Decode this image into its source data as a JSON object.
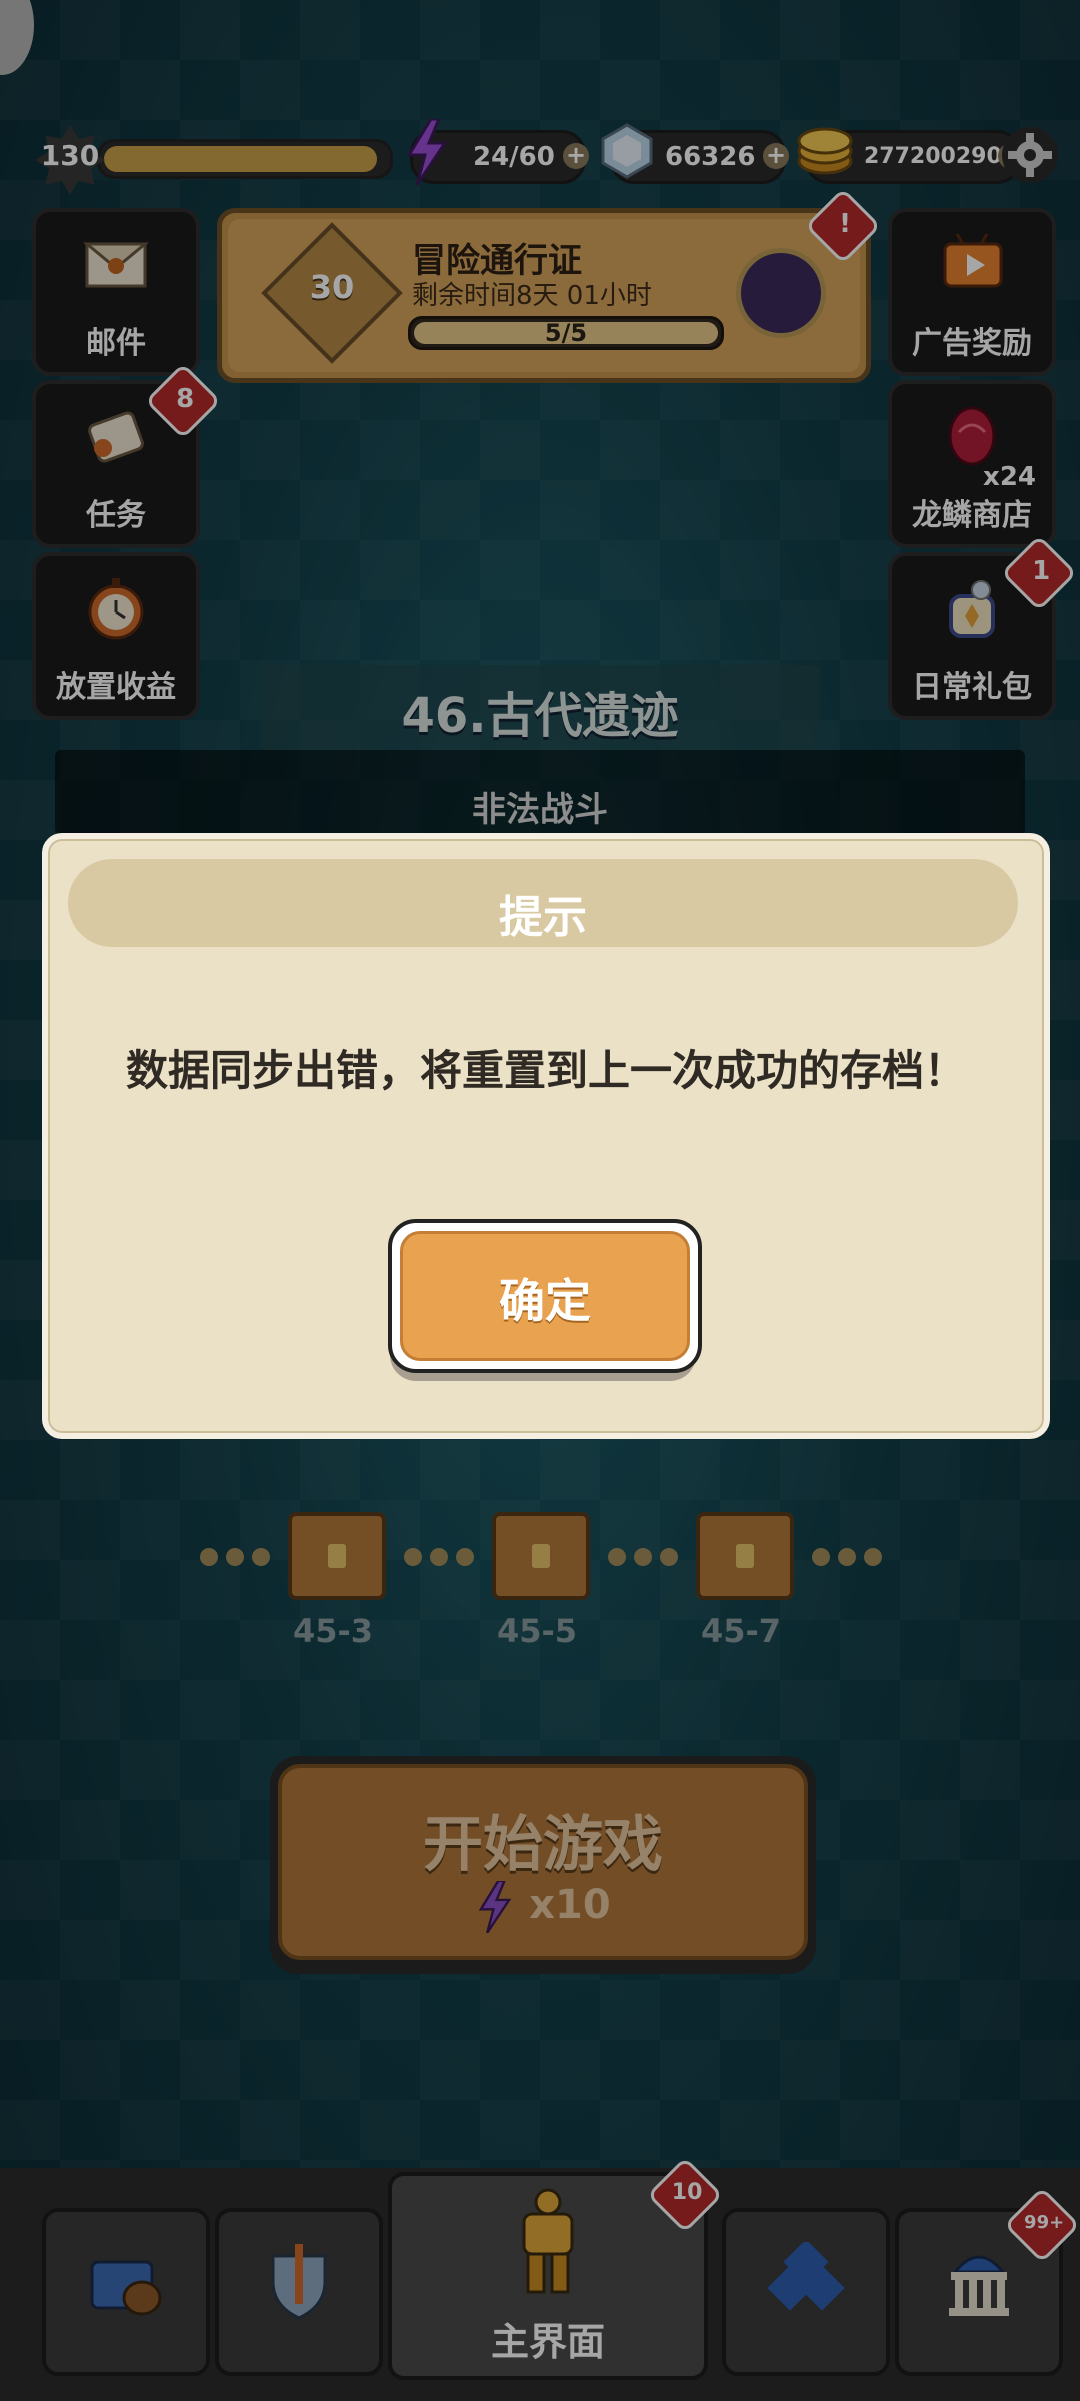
{
  "topbar": {
    "level": "130",
    "level_progress": 0.94,
    "energy": "24/60",
    "gems": "66326",
    "gold": "277200290"
  },
  "left_buttons": [
    {
      "label": "邮件",
      "icon": "mail-icon"
    },
    {
      "label": "任务",
      "icon": "scroll-icon",
      "badge": "8"
    },
    {
      "label": "放置收益",
      "icon": "stopwatch-icon"
    }
  ],
  "right_buttons": [
    {
      "label": "广告奖励",
      "icon": "tv-icon"
    },
    {
      "label": "龙鳞商店",
      "icon": "dragon-scale-icon",
      "count": "x24"
    },
    {
      "label": "日常礼包",
      "icon": "gift-jar-icon",
      "badge": "1"
    }
  ],
  "pass": {
    "level": "30",
    "title": "冒险通行证",
    "remaining": "剩余时间8天 01小时",
    "progress": "5/5",
    "badge": "!"
  },
  "stage": {
    "title": "46.古代遗迹",
    "subtitle": "非法战斗",
    "nodes": [
      "45-3",
      "45-5",
      "45-7"
    ]
  },
  "dialog": {
    "title": "提示",
    "message": "数据同步出错，将重置到上一次成功的存档！",
    "ok_label": "确定"
  },
  "start_button": {
    "label": "开始游戏",
    "cost": "x10"
  },
  "bottom_nav": {
    "main_label": "主界面",
    "main_badge": "10",
    "last_badge": "99+"
  },
  "colors": {
    "accent_orange": "#e9a24f",
    "dialog_bg": "#ebe1c7",
    "badge_red": "#b42a2a"
  }
}
